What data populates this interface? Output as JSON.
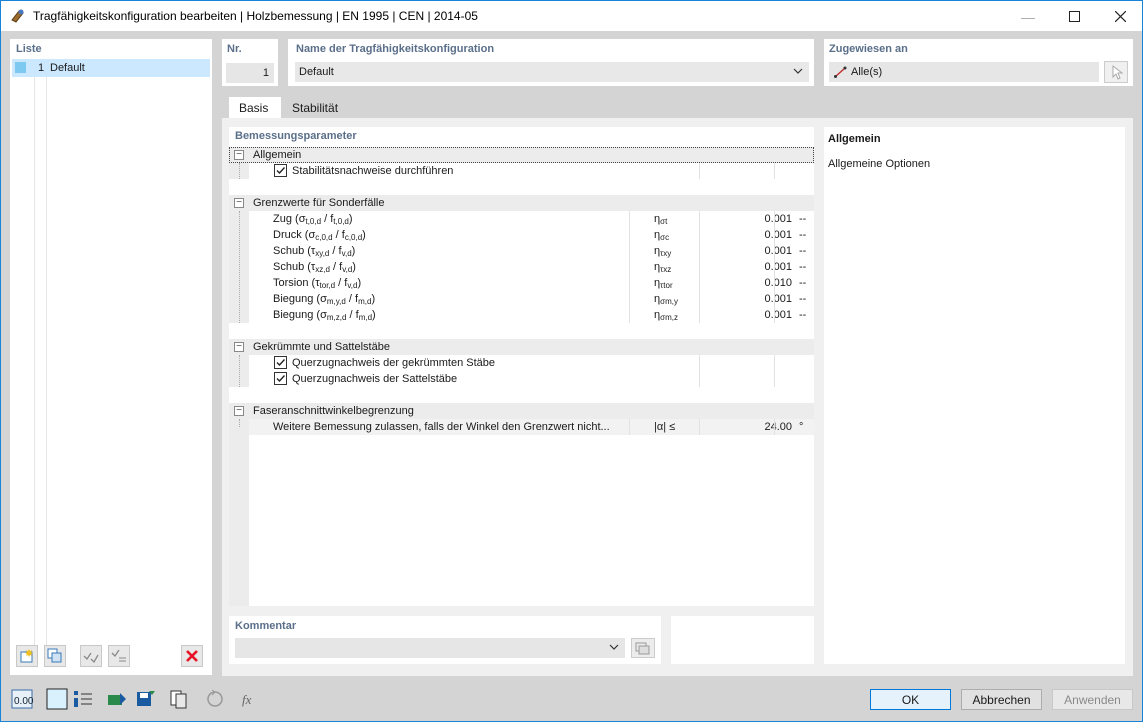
{
  "window": {
    "title": "Tragfähigkeitskonfiguration bearbeiten | Holzbemessung | EN 1995 | CEN | 2014-05"
  },
  "list": {
    "label": "Liste",
    "items": [
      {
        "num": "1",
        "name": "Default"
      }
    ]
  },
  "nr": {
    "label": "Nr.",
    "value": "1"
  },
  "name": {
    "label": "Name der Tragfähigkeitskonfiguration",
    "value": "Default"
  },
  "assigned": {
    "label": "Zugewiesen an",
    "value": "Alle(s)"
  },
  "tabs": [
    "Basis",
    "Stabilität"
  ],
  "params": {
    "label": "Bemessungsparameter",
    "sections": [
      {
        "title": "Allgemein"
      },
      {
        "title": "Grenzwerte für Sonderfälle"
      },
      {
        "title": "Gekrümmte und Sattelstäbe"
      },
      {
        "title": "Faseranschnittwinkelbegrenzung"
      }
    ],
    "general_rows": [
      {
        "label": "Stabilitätsnachweise durchführen",
        "checked": true
      }
    ],
    "limit_rows": [
      {
        "name": "Zug",
        "sym": "η",
        "sym_sub": "σt",
        "value": "0.001",
        "unit": "--"
      },
      {
        "name": "Druck",
        "sym": "η",
        "sym_sub": "σc",
        "value": "0.001",
        "unit": "--"
      },
      {
        "name": "Schub",
        "sym": "η",
        "sym_sub": "τxy",
        "value": "0.001",
        "unit": "--"
      },
      {
        "name": "Schub",
        "sym": "η",
        "sym_sub": "τxz",
        "value": "0.001",
        "unit": "--"
      },
      {
        "name": "Torsion",
        "sym": "η",
        "sym_sub": "τtor",
        "value": "0.010",
        "unit": "--"
      },
      {
        "name": "Biegung",
        "sym": "η",
        "sym_sub": "σm,y",
        "value": "0.001",
        "unit": "--"
      },
      {
        "name": "Biegung",
        "sym": "η",
        "sym_sub": "σm,z",
        "value": "0.001",
        "unit": "--"
      }
    ],
    "curved_rows": [
      {
        "label": "Querzugnachweis der gekrümmten Stäbe",
        "checked": true
      },
      {
        "label": "Querzugnachweis der Sattelstäbe",
        "checked": true
      }
    ],
    "fiber_rows": [
      {
        "label": "Weitere Bemessung zulassen, falls der Winkel den Grenzwert nicht...",
        "sym": "|α| ≤",
        "value": "24.00",
        "unit": "°"
      }
    ]
  },
  "info": {
    "title": "Allgemein",
    "text": "Allgemeine Optionen"
  },
  "comment": {
    "label": "Kommentar",
    "value": ""
  },
  "buttons": {
    "ok": "OK",
    "cancel": "Abbrechen",
    "apply": "Anwenden"
  },
  "colors": {
    "accent": "#1883d7",
    "selection": "#cce8ff",
    "delete": "#e81123"
  }
}
